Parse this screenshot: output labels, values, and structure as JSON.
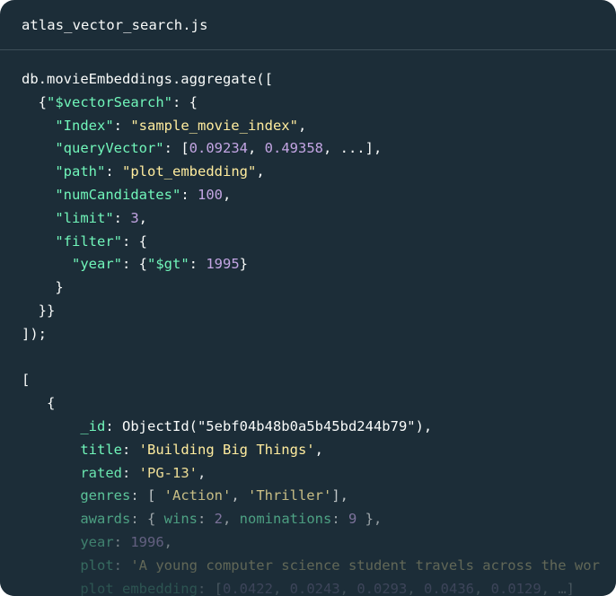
{
  "window": {
    "filename": "atlas_vector_search.js"
  },
  "query": {
    "l1": "db.movieEmbeddings.aggregate([",
    "l2_open": "{",
    "l2_key": "\"$vectorSearch\"",
    "l2_rest": ": {",
    "l3_key": "\"Index\"",
    "l3_sep": ": ",
    "l3_val": "\"sample_movie_index\"",
    "l3_end": ",",
    "l4_key": "\"queryVector\"",
    "l4_sep": ": [",
    "l4_v1": "0.09234",
    "l4_comma": ", ",
    "l4_v2": "0.49358",
    "l4_end": ", ...],",
    "l5_key": "\"path\"",
    "l5_sep": ": ",
    "l5_val": "\"plot_embedding\"",
    "l5_end": ",",
    "l6_key": "\"numCandidates\"",
    "l6_sep": ": ",
    "l6_val": "100",
    "l6_end": ",",
    "l7_key": "\"limit\"",
    "l7_sep": ": ",
    "l7_val": "3",
    "l7_end": ",",
    "l8_key": "\"filter\"",
    "l8_rest": ": {",
    "l9_key": "\"year\"",
    "l9_sep": ": {",
    "l9_op": "\"$gt\"",
    "l9_sep2": ": ",
    "l9_val": "1995",
    "l9_end": "}",
    "l10": "}",
    "l11": "}}",
    "l12": "]);"
  },
  "result": {
    "open_bracket": "[",
    "open_brace": "{",
    "id_key": "_id",
    "id_val": ": ObjectId(\"5ebf04b48b0a5b45bd244b79\"),",
    "title_key": "title",
    "title_sep": ": ",
    "title_val": "'Building Big Things'",
    "title_end": ",",
    "rated_key": "rated",
    "rated_sep": ": ",
    "rated_val": "'PG-13'",
    "rated_end": ",",
    "genres_key": "genres",
    "genres_sep": ": [ ",
    "genres_v1": "'Action'",
    "genres_comma": ", ",
    "genres_v2": "'Thriller'",
    "genres_end": "],",
    "awards_key": "awards",
    "awards_sep": ": { ",
    "wins_key": "wins",
    "wins_sep": ": ",
    "wins_val": "2",
    "wins_comma": ", ",
    "noms_key": "nominations",
    "noms_sep": ": ",
    "noms_val": "9",
    "awards_end": " },",
    "year_key": "year",
    "year_sep": ": ",
    "year_val": "1996",
    "year_end": ",",
    "plot_key": "plot",
    "plot_sep": ": ",
    "plot_val": "'A young computer science student travels across the wor",
    "emb_key": "plot_embedding",
    "emb_sep": ": [",
    "emb_v1": "0.0422",
    "emb_v2": "0.0243",
    "emb_v3": "0.0293",
    "emb_v4": "0.0436",
    "emb_v5": "0.0129",
    "emb_comma": ", ",
    "emb_end": ", …]"
  },
  "colors": {
    "background": "#1c2d38",
    "key": "#71f6ba",
    "string": "#ffec9e",
    "number": "#c3a5e3",
    "plain": "#f9fbfa"
  }
}
